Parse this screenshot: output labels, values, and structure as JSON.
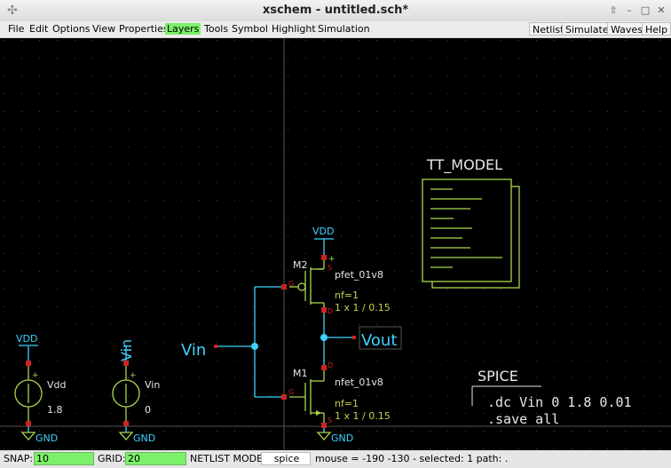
{
  "window": {
    "title": "xschem - untitled.sch*",
    "app_icon": "xschem-app-icon",
    "controls": [
      "minimize-up",
      "minimize",
      "maximize",
      "close"
    ]
  },
  "menu": {
    "items": [
      "File",
      "Edit",
      "Options",
      "View",
      "Properties",
      "Layers",
      "Tools",
      "Symbol",
      "Highlight",
      "Simulation"
    ],
    "active": "Layers",
    "right_buttons": [
      "Netlist",
      "Simulate",
      "Waves",
      "Help"
    ]
  },
  "schematic": {
    "pmos": {
      "name": "M2",
      "model": "pfet_01v8",
      "nf": "nf=1",
      "dims": "1 x 1 / 0.15",
      "pin_s": "S",
      "pin_g": "G",
      "pin_d": "D",
      "supply": "VDD",
      "pin_plus": "+"
    },
    "nmos": {
      "name": "M1",
      "model": "nfet_01v8",
      "nf": "nf=1",
      "dims": "1 x 1 / 0.15",
      "pin_d": "D",
      "pin_g": "G",
      "pin_s": "S",
      "ground": "GND"
    },
    "vin_label": "Vin",
    "vout_label": "Vout",
    "vdd_source": {
      "top": "VDD",
      "name": "Vdd",
      "value": "1.8",
      "ground": "GND",
      "plus": "+"
    },
    "vin_source": {
      "top": "Vin",
      "name": "Vin",
      "value": "0",
      "ground": "GND",
      "plus": "+"
    },
    "tt_model": {
      "title": "TT_MODEL"
    },
    "spice": {
      "title": "SPICE",
      "lines": [
        ".dc Vin 0 1.8 0.01",
        ".save all"
      ]
    },
    "colors": {
      "wire": "#3fd2ff",
      "component": "#a8d84a",
      "pin": "#cc2222",
      "text": "#e8e8e8",
      "accent_text": "#c8d050",
      "label": "#3fb0d0"
    }
  },
  "status": {
    "snap_label": "SNAP:",
    "snap_value": "10",
    "grid_label": "GRID:",
    "grid_value": "20",
    "netlist_label": "NETLIST MODE:",
    "netlist_value": "spice",
    "info": "mouse = -190 -130 - selected: 1 path: ."
  }
}
